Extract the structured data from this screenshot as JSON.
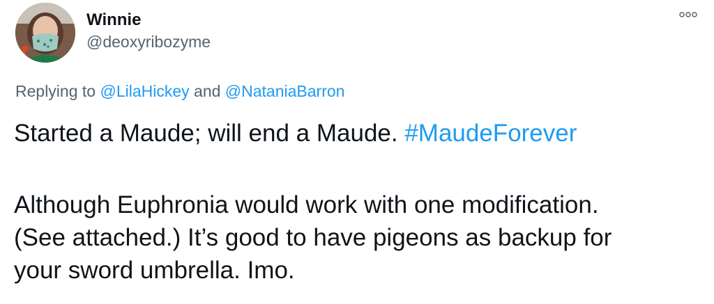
{
  "author": {
    "display_name": "Winnie",
    "handle": "@deoxyribozyme"
  },
  "reply": {
    "prefix": "Replying to ",
    "mention_1": "@LilaHickey",
    "joiner": " and ",
    "mention_2": "@NataniaBarron"
  },
  "tweet": {
    "line1_text": "Started a Maude; will end a Maude. ",
    "hashtag": "#MaudeForever",
    "line2": "Although Euphronia would work with one modification.",
    "line3": "(See attached.) It’s good to have pigeons as backup for",
    "line4": "your sword umbrella. Imo."
  },
  "icons": {
    "more": "more-options-icon",
    "avatar": "avatar"
  },
  "colors": {
    "link": "#1d9bf0",
    "secondary_text": "#536471",
    "primary_text": "#0f1419"
  }
}
